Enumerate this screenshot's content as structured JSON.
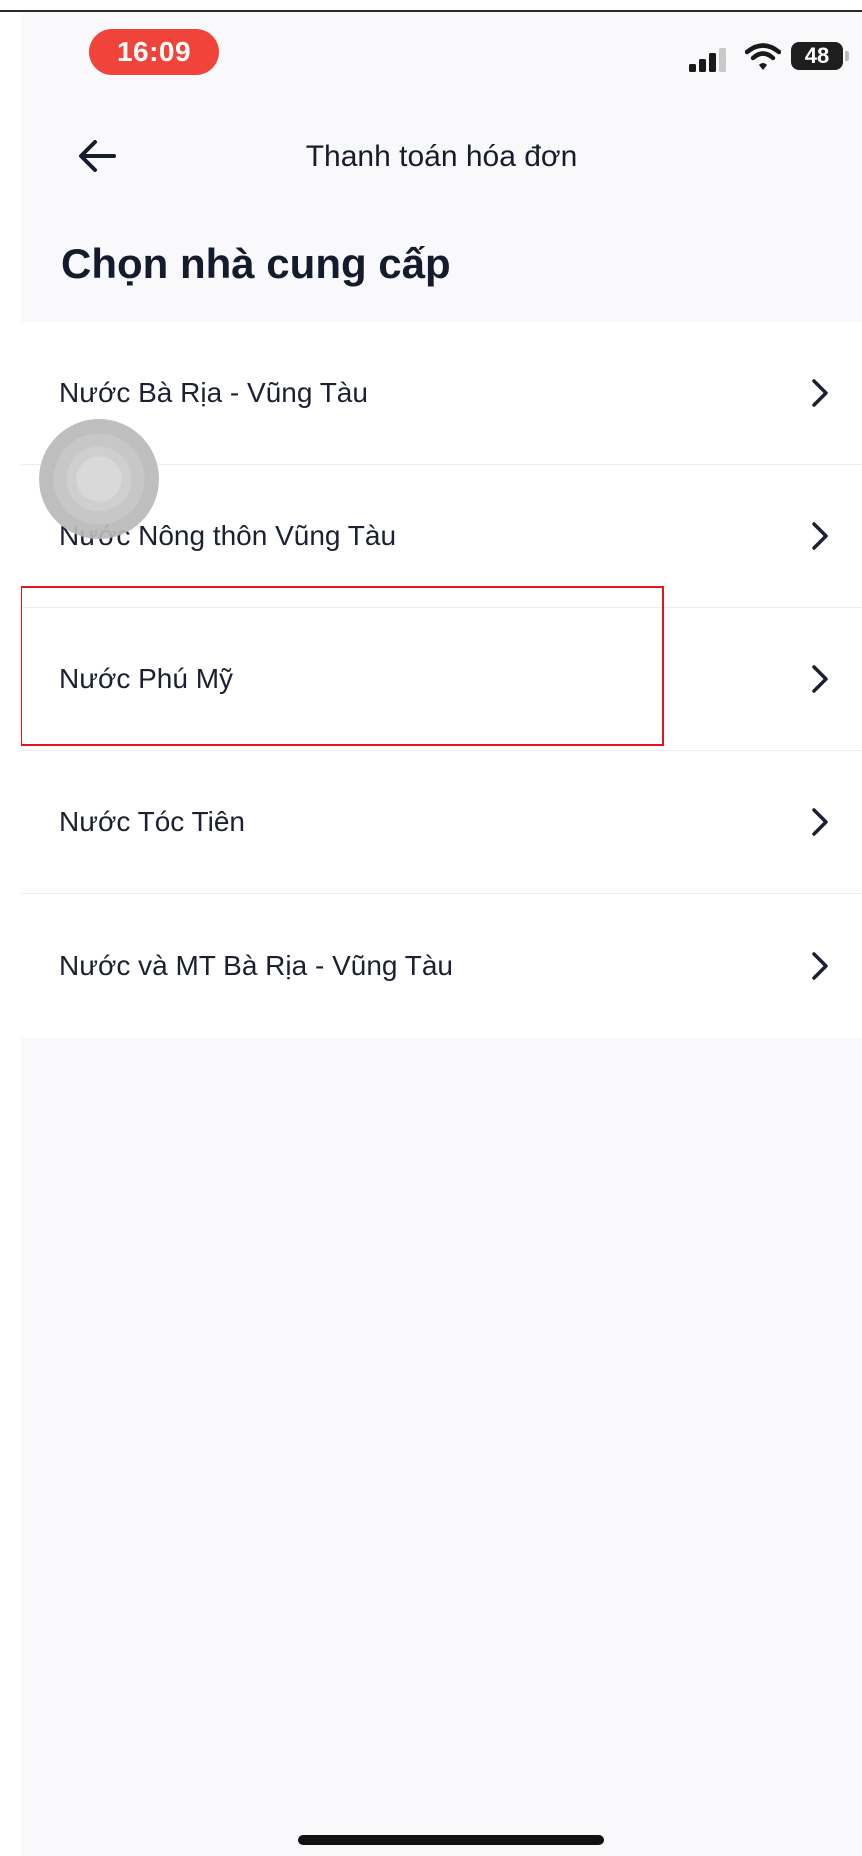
{
  "status_bar": {
    "time": "16:09",
    "battery": "48",
    "time_pill_color": "#f0433a",
    "icons": [
      "signal-icon",
      "wifi-icon",
      "battery-icon"
    ]
  },
  "header": {
    "title": "Thanh toán hóa đơn",
    "back_icon": "arrow-left-icon"
  },
  "page_title": "Chọn nhà cung cấp",
  "providers": [
    {
      "label": "Nước Bà Rịa - Vũng Tàu"
    },
    {
      "label": "Nước Nông thôn Vũng Tàu"
    },
    {
      "label": "Nước Phú Mỹ"
    },
    {
      "label": "Nước Tóc Tiên"
    },
    {
      "label": "Nước và MT Bà Rịa - Vũng Tàu"
    }
  ],
  "row_icon": "chevron-right-icon",
  "highlight_color": "#e0161a"
}
